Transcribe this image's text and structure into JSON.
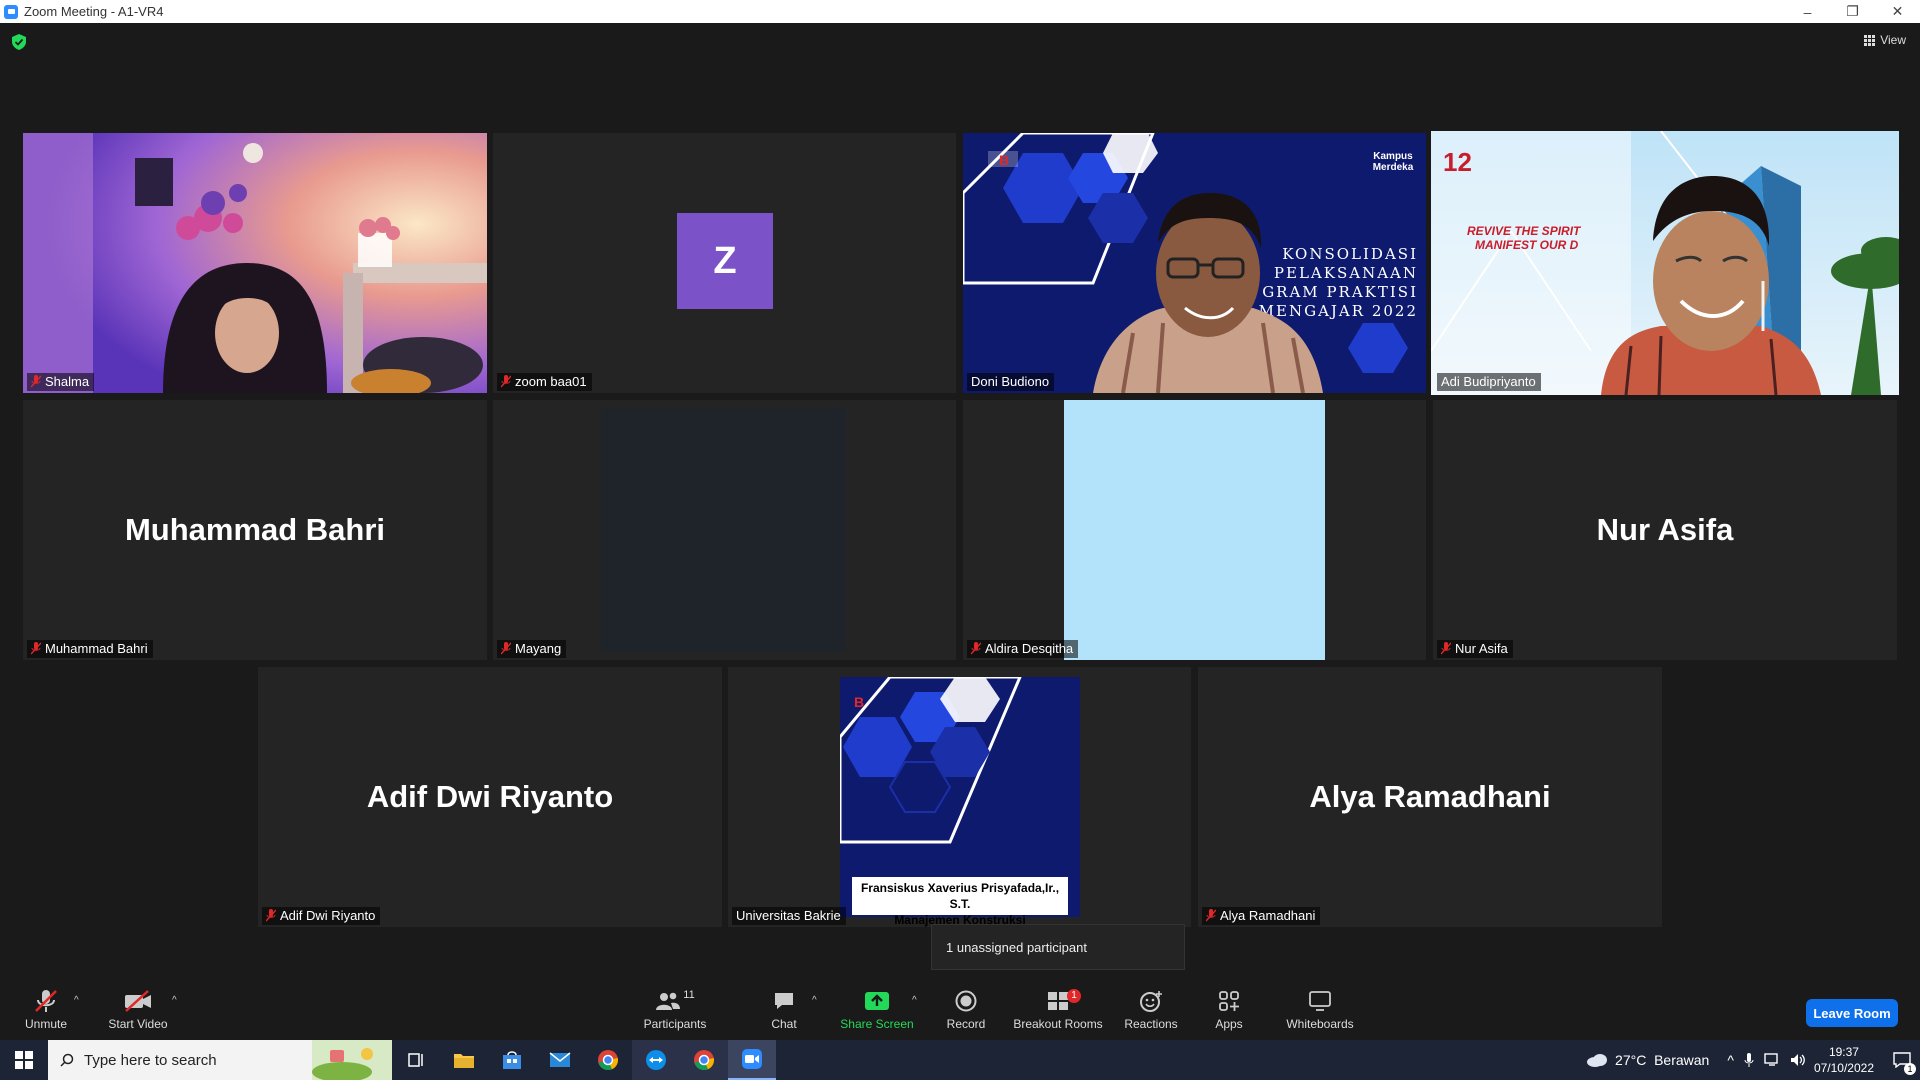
{
  "window": {
    "title": "Zoom Meeting - A1-VR4",
    "minimize": "–",
    "restore": "❐",
    "close": "✕"
  },
  "top": {
    "view_label": "View"
  },
  "tiles": [
    {
      "name": "Shalma",
      "muted": true
    },
    {
      "name": "zoom baa01",
      "muted": true,
      "avatar_letter": "Z",
      "avatar_color": "#7b52c7"
    },
    {
      "name": "Doni Budiono",
      "muted": false,
      "slide_text": [
        "KONSOLIDASI",
        "PELAKSANAAN",
        "GRAM PRAKTISI",
        "MENGAJAR 2022"
      ],
      "logo_text": "Kampus Merdeka"
    },
    {
      "name": "Adi Budipriyanto",
      "muted": false,
      "banner_text": [
        "REVIVE THE SPIRIT",
        "MANIFEST OUR D"
      ]
    },
    {
      "name": "Muhammad Bahri",
      "muted": true,
      "big_name": "Muhammad Bahri"
    },
    {
      "name": "Mayang",
      "muted": true
    },
    {
      "name": "Aldira Desqitha",
      "muted": true
    },
    {
      "name": "Nur Asifa",
      "muted": true,
      "big_name": "Nur Asifa"
    },
    {
      "name": "Adif Dwi Riyanto",
      "muted": true,
      "big_name": "Adif Dwi Riyanto"
    },
    {
      "name": "Universitas Bakrie",
      "muted": false,
      "caption": [
        "Fransiskus Xaverius Prisyafada,Ir., S.T.",
        "Manajemen Konstruksi"
      ]
    },
    {
      "name": "Alya Ramadhani",
      "muted": true,
      "big_name": "Alya Ramadhani"
    }
  ],
  "tooltip": "1 unassigned participant",
  "toolbar": {
    "unmute": "Unmute",
    "start_video": "Start Video",
    "participants": "Participants",
    "participants_count": "11",
    "chat": "Chat",
    "share_screen": "Share Screen",
    "record": "Record",
    "breakout_rooms": "Breakout Rooms",
    "breakout_badge": "1",
    "reactions": "Reactions",
    "apps": "Apps",
    "whiteboards": "Whiteboards",
    "leave": "Leave Room"
  },
  "colors": {
    "accent": "#0e71eb",
    "active_speaker": "#f6ea3b",
    "share_green": "#23d959",
    "muted_red": "#e02828"
  },
  "taskbar": {
    "search_placeholder": "Type here to search",
    "weather": "27°C  Berawan",
    "time": "19:37",
    "date": "07/10/2022",
    "notification_count": "1"
  }
}
